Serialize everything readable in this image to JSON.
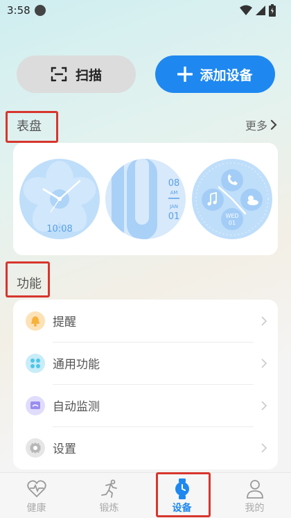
{
  "status": {
    "time": "3:58"
  },
  "actions": {
    "scan_label": "扫描",
    "add_label": "添加设备"
  },
  "watchfaces": {
    "title": "表盘",
    "more_label": "更多",
    "face1_time": "10:08",
    "face2_date_top": "08",
    "face2_am": "AM",
    "face2_month": "JAN",
    "face2_date_bottom": "01",
    "face3_day": "WED",
    "face3_date": "01"
  },
  "functions": {
    "title": "功能",
    "items": [
      {
        "label": "提醒",
        "icon": "bell-icon",
        "color": "#f7b23b"
      },
      {
        "label": "通用功能",
        "icon": "grid-icon",
        "color": "#4ec6e8"
      },
      {
        "label": "自动监测",
        "icon": "monitor-icon",
        "color": "#9a8cf0"
      },
      {
        "label": "设置",
        "icon": "gear-icon",
        "color": "#b8b8b8"
      }
    ]
  },
  "tabs": [
    {
      "label": "健康",
      "icon": "heart-pulse-icon"
    },
    {
      "label": "锻炼",
      "icon": "running-icon"
    },
    {
      "label": "设备",
      "icon": "watch-icon",
      "active": true
    },
    {
      "label": "我的",
      "icon": "person-icon"
    }
  ],
  "accent_color": "#1e88f0",
  "highlight_color": "#d7352d"
}
